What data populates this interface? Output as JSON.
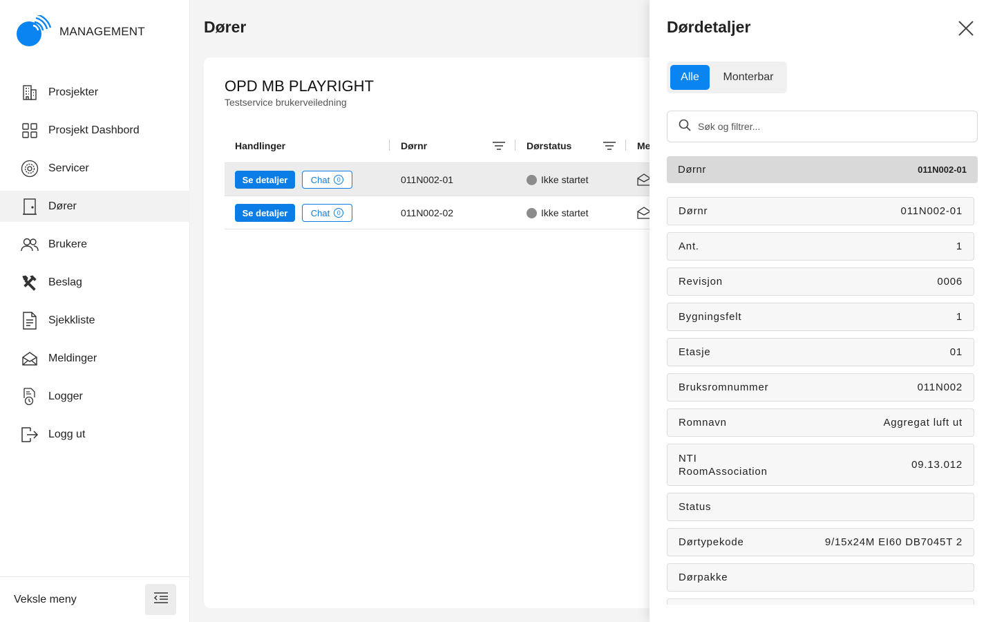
{
  "brand": {
    "name": "MANAGEMENT",
    "color": "#0a84f0"
  },
  "sidebar": {
    "items": [
      {
        "label": "Prosjekter",
        "icon": "building-icon"
      },
      {
        "label": "Prosjekt Dashbord",
        "icon": "grid-icon"
      },
      {
        "label": "Servicer",
        "icon": "gear-icon"
      },
      {
        "label": "Dører",
        "icon": "door-icon",
        "active": true
      },
      {
        "label": "Brukere",
        "icon": "users-icon"
      },
      {
        "label": "Beslag",
        "icon": "tools-icon"
      },
      {
        "label": "Sjekkliste",
        "icon": "document-icon"
      },
      {
        "label": "Meldinger",
        "icon": "envelope-icon"
      },
      {
        "label": "Logger",
        "icon": "log-icon"
      },
      {
        "label": "Logg ut",
        "icon": "logout-icon"
      }
    ],
    "footer_label": "Veksle meny"
  },
  "main": {
    "title": "Dører",
    "project_name": "OPD MB PLAYRIGHT",
    "project_subtitle": "Testservice brukerveiledning",
    "columns": [
      "Handlinger",
      "Dørnr",
      "Dørstatus",
      "Me"
    ],
    "rows": [
      {
        "details_label": "Se detaljer",
        "chat_label": "Chat",
        "chat_count": "0",
        "door_no": "011N002-01",
        "status": "Ikke startet"
      },
      {
        "details_label": "Se detaljer",
        "chat_label": "Chat",
        "chat_count": "0",
        "door_no": "011N002-02",
        "status": "Ikke startet"
      }
    ]
  },
  "panel": {
    "title": "Dørdetaljer",
    "tabs": [
      "Alle",
      "Monterbar"
    ],
    "search_placeholder": "Søk og filtrer...",
    "summary": {
      "key": "Dørnr",
      "value": "011N002-01"
    },
    "fields": [
      {
        "key": "Dørnr",
        "value": "011N002-01"
      },
      {
        "key": "Ant.",
        "value": "1"
      },
      {
        "key": "Revisjon",
        "value": "0006"
      },
      {
        "key": "Bygningsfelt",
        "value": "1"
      },
      {
        "key": "Etasje",
        "value": "01"
      },
      {
        "key": "Bruksromnummer",
        "value": "011N002"
      },
      {
        "key": "Romnavn",
        "value": "Aggregat luft ut"
      },
      {
        "key": "NTI RoomAssociation",
        "value": "09.13.012"
      },
      {
        "key": "Status",
        "value": ""
      },
      {
        "key": "Dørtypekode",
        "value": "9/15x24M EI60 DB7045T 2"
      },
      {
        "key": "Dørpakke",
        "value": ""
      },
      {
        "key": "",
        "value": ""
      }
    ]
  }
}
